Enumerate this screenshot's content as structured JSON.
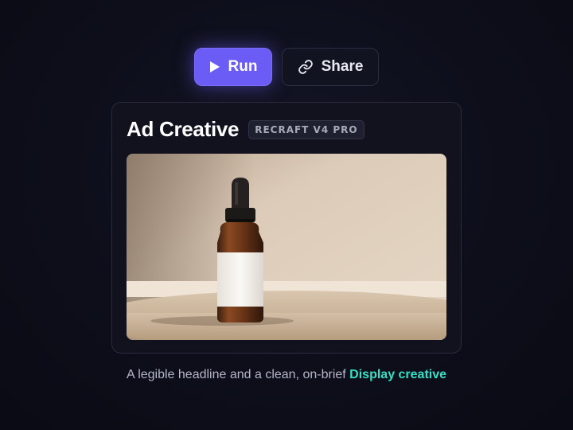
{
  "toolbar": {
    "run_label": "Run",
    "run_icon": "play-icon",
    "share_label": "Share",
    "share_icon": "link-icon",
    "accent_color": "#6b5cf5"
  },
  "card": {
    "title": "Ad Creative",
    "model_badge": "RECRAFT V4 PRO",
    "image_description": "amber-dropper-bottle-product-photo"
  },
  "caption": {
    "text": "A legible headline and a clean, on-brief",
    "highlight": "Display creative",
    "highlight_color": "#35e0c7"
  }
}
